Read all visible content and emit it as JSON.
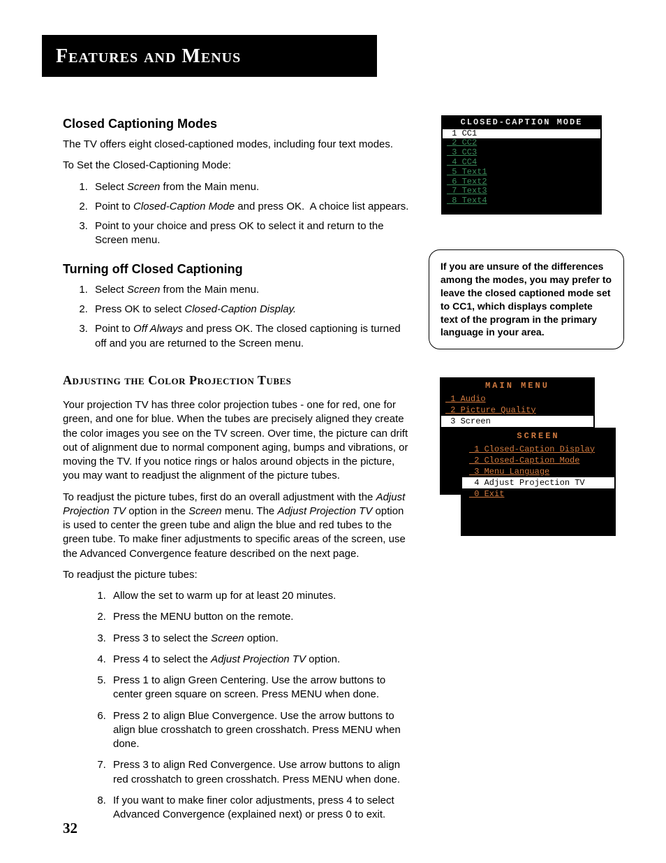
{
  "banner": "Features and Menus",
  "pagenum": "32",
  "left": {
    "ccm_head": "Closed Captioning Modes",
    "ccm_intro": "The TV offers eight closed-captioned modes, including four text modes.",
    "ccm_toset": "To Set the Closed-Captioning Mode:",
    "ccm_steps": [
      "Select Screen from the Main menu.",
      "Point to Closed-Caption Mode and press OK.  A choice list appears.",
      "Point to your choice and press OK to select it and return to the Screen menu."
    ],
    "off_head": "Turning off Closed Captioning",
    "off_steps": [
      "Select Screen from the Main menu.",
      "Press OK to select Closed-Caption Display.",
      "Point to Off Always and press OK. The closed captioning is turned off and you are returned to the Screen menu."
    ],
    "adj_head": "Adjusting the Color Projection Tubes",
    "adj_p1": "Your projection TV has three color projection tubes - one for red, one for green, and one for blue. When the tubes are precisely aligned they create the color images you see on the TV screen. Over time, the picture can drift out of alignment due to normal component aging, bumps and vibrations, or moving the TV. If you notice rings or halos around objects in the picture, you may want to readjust the alignment of the picture tubes.",
    "adj_p2": "To readjust the picture tubes, first do an overall adjustment with the Adjust Projection TV option in the Screen menu. The Adjust Projection TV option is used to center the green tube and align the blue and red tubes to the green tube. To make finer adjustments to specific areas of the screen, use the Advanced Convergence feature described on the next page.",
    "adj_lead": "To readjust the picture tubes:",
    "adj_steps": [
      "Allow the set to warm up for at least 20 minutes.",
      "Press the MENU button on the remote.",
      "Press 3 to select the Screen option.",
      "Press 4 to select the Adjust Projection TV option.",
      "Press 1 to align Green Centering.  Use the arrow buttons to center green square on screen.  Press MENU when done.",
      "Press 2 to align Blue Convergence.  Use the arrow buttons to align blue crosshatch to green crosshatch.  Press MENU when done.",
      "Press 3 to align Red Convergence.  Use arrow buttons to align red crosshatch to green crosshatch.  Press MENU when done.",
      "If you want to make finer color adjustments, press 4 to select Advanced Convergence (explained next) or press 0 to exit."
    ]
  },
  "right": {
    "cc_title": "CLOSED-CAPTION MODE",
    "cc_rows": [
      {
        "n": "1",
        "t": "CC1",
        "sel": true
      },
      {
        "n": "2",
        "t": "CC2",
        "sel": false
      },
      {
        "n": "3",
        "t": "CC3",
        "sel": false
      },
      {
        "n": "4",
        "t": "CC4",
        "sel": false
      },
      {
        "n": "5",
        "t": "Text1",
        "sel": false
      },
      {
        "n": "6",
        "t": "Text2",
        "sel": false
      },
      {
        "n": "7",
        "t": "Text3",
        "sel": false
      },
      {
        "n": "8",
        "t": "Text4",
        "sel": false
      }
    ],
    "tip": "If you are unsure of the differences among the modes, you may prefer to leave the closed captioned mode set to CC1, which displays complete text of the program in the primary language in your area.",
    "main_title": "MAIN MENU",
    "main_rows": [
      {
        "n": "1",
        "t": "Audio",
        "sel": false
      },
      {
        "n": "2",
        "t": "Picture Quality",
        "sel": false
      },
      {
        "n": "3",
        "t": "Screen",
        "sel": true
      }
    ],
    "screen_title": "SCREEN",
    "screen_rows": [
      {
        "n": "1",
        "t": "Closed-Caption Display",
        "sel": false
      },
      {
        "n": "2",
        "t": "Closed-Caption Mode",
        "sel": false
      },
      {
        "n": "3",
        "t": "Menu Language",
        "sel": false
      },
      {
        "n": "4",
        "t": "Adjust Projection TV",
        "sel": true
      },
      {
        "n": "0",
        "t": "Exit",
        "sel": false
      }
    ]
  }
}
